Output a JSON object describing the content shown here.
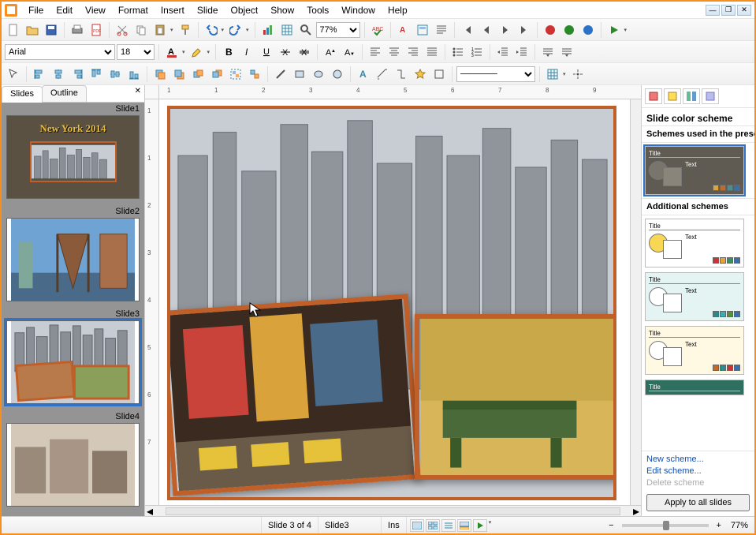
{
  "menus": [
    "File",
    "Edit",
    "View",
    "Format",
    "Insert",
    "Slide",
    "Object",
    "Show",
    "Tools",
    "Window",
    "Help"
  ],
  "toolbar1": {
    "zoom_value": "77%"
  },
  "toolbar2": {
    "font_name": "Arial",
    "font_size": "18"
  },
  "leftPanel": {
    "tab_slides": "Slides",
    "tab_outline": "Outline",
    "slides": [
      {
        "label": "Slide1",
        "title": "New York 2014"
      },
      {
        "label": "Slide2"
      },
      {
        "label": "Slide3"
      },
      {
        "label": "Slide4"
      }
    ],
    "selected_index": 2
  },
  "canvas": {
    "hruler": [
      "1",
      "1",
      "2",
      "3",
      "4",
      "5",
      "6",
      "7",
      "8",
      "9"
    ],
    "vruler": [
      "1",
      "1",
      "2",
      "3",
      "4",
      "5",
      "6",
      "7"
    ]
  },
  "rightPanel": {
    "title": "Slide color scheme",
    "section_used": "Schemes used in the presentation",
    "section_additional": "Additional schemes",
    "used_scheme_bg": "#5f5a52",
    "additional_schemes": [
      {
        "bg": "#ffffff",
        "circle": "#f7d754"
      },
      {
        "bg": "#e3f4f2",
        "circle": "#ffffff"
      },
      {
        "bg": "#fff9e4",
        "circle": "#ffffff"
      },
      {
        "bg": "#2f6f60",
        "circle": "#ffffff"
      }
    ],
    "scheme_title_label": "Title",
    "scheme_text_label": "Text",
    "link_new": "New scheme...",
    "link_edit": "Edit scheme...",
    "link_delete": "Delete scheme",
    "apply_label": "Apply to all slides"
  },
  "statusbar": {
    "position": "Slide 3 of 4",
    "name": "Slide3",
    "ins": "Ins",
    "zoom": "77%"
  }
}
